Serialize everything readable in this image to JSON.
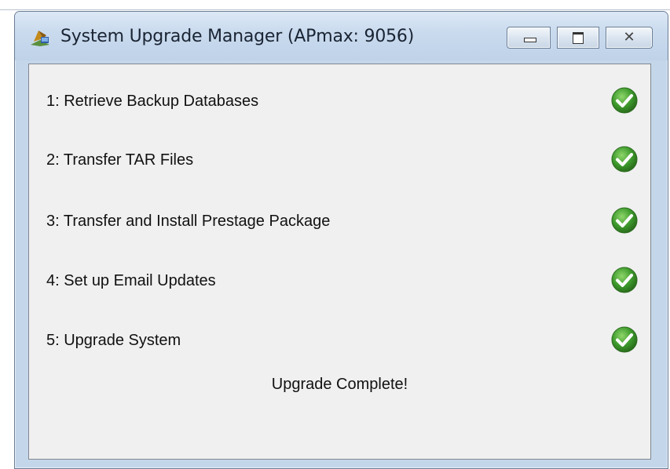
{
  "window": {
    "title": "System Upgrade Manager (APmax: 9056)",
    "icon": "upgrade-app-icon",
    "controls": {
      "minimize": "minimize-icon",
      "maximize": "maximize-icon",
      "close_glyph": "✕"
    }
  },
  "steps": [
    {
      "label": "1: Retrieve Backup Databases",
      "status_icon": "check-icon",
      "complete": true
    },
    {
      "label": "2: Transfer TAR Files",
      "status_icon": "check-icon",
      "complete": true
    },
    {
      "label": "3: Transfer and Install Prestage Package",
      "status_icon": "check-icon",
      "complete": true
    },
    {
      "label": "4: Set up Email Updates",
      "status_icon": "check-icon",
      "complete": true
    },
    {
      "label": "5: Upgrade System",
      "status_icon": "check-icon",
      "complete": true
    }
  ],
  "status_message": "Upgrade Complete!",
  "colors": {
    "check_green": "#3d9a2c",
    "titlebar_blue": "#c9daee",
    "panel_gray": "#f0f0f0"
  }
}
